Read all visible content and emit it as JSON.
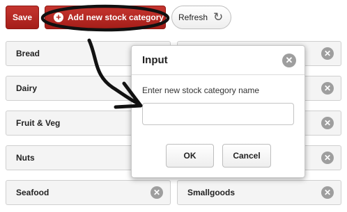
{
  "toolbar": {
    "save_label": "Save",
    "add_label": "Add new stock category",
    "refresh_label": "Refresh"
  },
  "categories": [
    {
      "name": "Bread"
    },
    {
      "name": ""
    },
    {
      "name": "Dairy"
    },
    {
      "name": ""
    },
    {
      "name": "Fruit & Veg"
    },
    {
      "name": ""
    },
    {
      "name": "Nuts"
    },
    {
      "name": ""
    },
    {
      "name": "Seafood"
    },
    {
      "name": "Smallgoods"
    }
  ],
  "dialog": {
    "title": "Input",
    "prompt": "Enter new stock category name",
    "input_value": "",
    "ok_label": "OK",
    "cancel_label": "Cancel"
  },
  "icons": {
    "add": "plus-icon",
    "refresh": "refresh-icon",
    "remove": "close-icon",
    "annotation": "curved-arrow"
  },
  "colors": {
    "primary_red": "#b32620",
    "annotation": "#111111",
    "tile_bg": "#f4f4f4",
    "close_icon_bg": "#9e9e9e"
  }
}
